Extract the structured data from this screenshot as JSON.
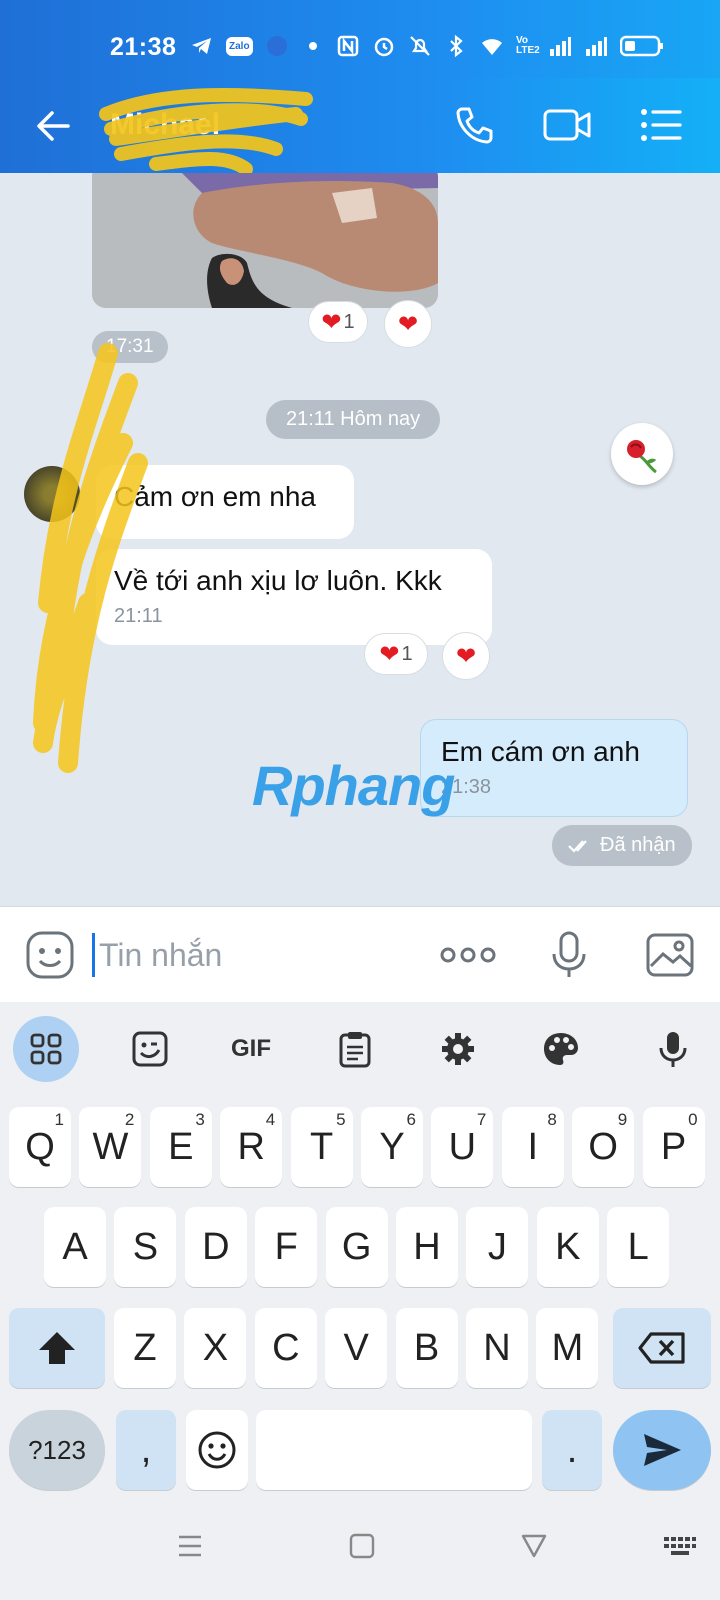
{
  "status_bar": {
    "time": "21:38",
    "zalo_label": "Zalo",
    "volte": "Vo LTE2"
  },
  "header": {
    "contact_name": "Michael"
  },
  "chat": {
    "photo_reactions": {
      "count": "1"
    },
    "photo_time": "17:31",
    "day_separator": "21:11 Hôm nay",
    "messages": [
      {
        "text": "Cảm ơn em nha"
      },
      {
        "text": "Về tới anh xịu lơ luôn. Kkk",
        "time": "21:11"
      }
    ],
    "message_reactions": {
      "count": "1"
    },
    "my_message": {
      "text": "Em cám ơn anh",
      "time": "21:38"
    },
    "delivery_status": "Đã nhận",
    "watermark": "Rphang"
  },
  "input": {
    "placeholder": "Tin nhắn"
  },
  "keyboard": {
    "toolbar_gif": "GIF",
    "row1": [
      {
        "k": "Q",
        "n": "1"
      },
      {
        "k": "W",
        "n": "2"
      },
      {
        "k": "E",
        "n": "3"
      },
      {
        "k": "R",
        "n": "4"
      },
      {
        "k": "T",
        "n": "5"
      },
      {
        "k": "Y",
        "n": "6"
      },
      {
        "k": "U",
        "n": "7"
      },
      {
        "k": "I",
        "n": "8"
      },
      {
        "k": "O",
        "n": "9"
      },
      {
        "k": "P",
        "n": "0"
      }
    ],
    "row2": [
      "A",
      "S",
      "D",
      "F",
      "G",
      "H",
      "J",
      "K",
      "L"
    ],
    "row3": [
      "Z",
      "X",
      "C",
      "V",
      "B",
      "N",
      "M"
    ],
    "sym_key": "?123",
    "comma_key": ",",
    "period_key": "."
  }
}
